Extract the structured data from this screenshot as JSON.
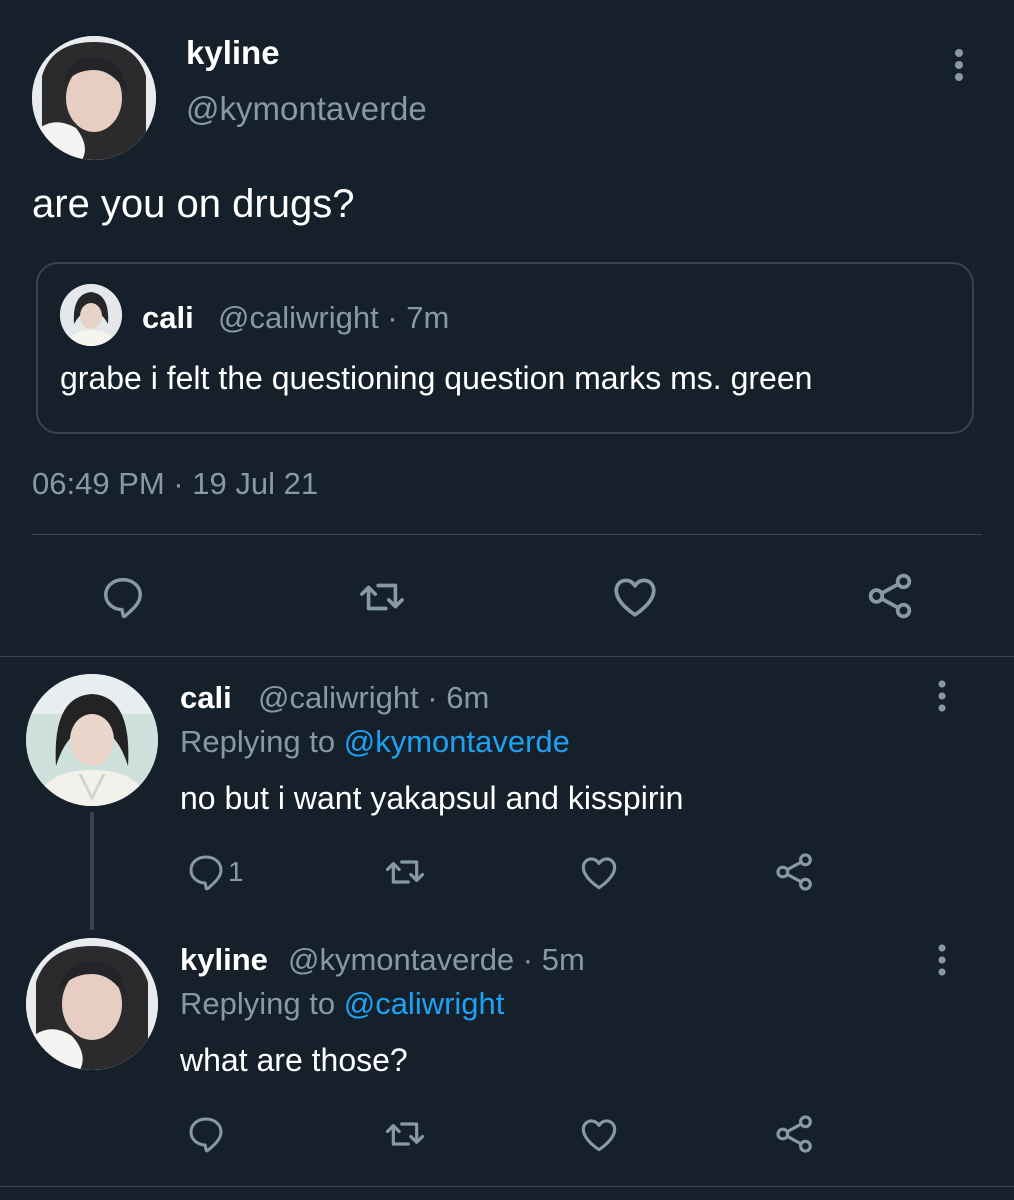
{
  "main_tweet": {
    "author_name": "kyline",
    "author_handle": "@kymontaverde",
    "text": "are you on drugs?",
    "timestamp": "06:49 PM · 19 Jul 21",
    "quoted": {
      "author_name": "cali",
      "author_meta": "@caliwright · 7m",
      "text": "grabe i felt the questioning question marks ms. green"
    },
    "actions": {
      "reply_icon": "reply-icon",
      "retweet_icon": "retweet-icon",
      "like_icon": "heart-icon",
      "share_icon": "share-icon"
    }
  },
  "replies": [
    {
      "author_name": "cali",
      "author_meta": "@caliwright · 6m",
      "replying_prefix": "Replying to",
      "replying_to": "@kymontaverde",
      "text": "no but i want yakapsul and kisspirin",
      "reply_count": "1"
    },
    {
      "author_name": "kyline",
      "author_meta": "@kymontaverde · 5m",
      "replying_prefix": "Replying to",
      "replying_to": "@caliwright",
      "text": "what are those?",
      "reply_count": ""
    }
  ],
  "colors": {
    "background": "#15202b",
    "muted": "#8899a6",
    "link": "#1da1f2",
    "divider": "#38444d"
  }
}
